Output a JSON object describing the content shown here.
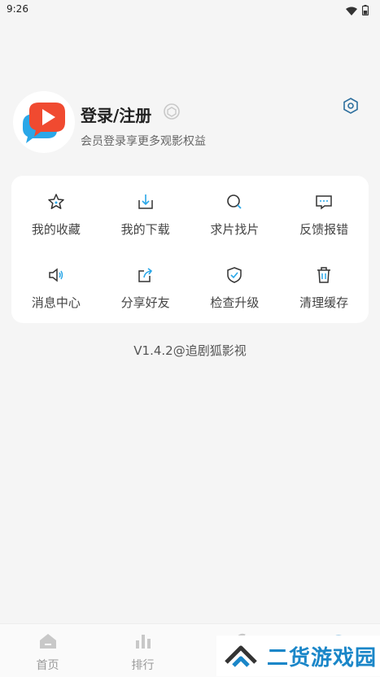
{
  "status": {
    "time": "9:26"
  },
  "profile": {
    "title": "登录/注册",
    "subtitle": "会员登录享更多观影权益"
  },
  "menu": {
    "items": [
      {
        "label": "我的收藏",
        "icon": "star-icon"
      },
      {
        "label": "我的下载",
        "icon": "download-icon"
      },
      {
        "label": "求片找片",
        "icon": "search-icon"
      },
      {
        "label": "反馈报错",
        "icon": "feedback-icon"
      },
      {
        "label": "消息中心",
        "icon": "speaker-icon"
      },
      {
        "label": "分享好友",
        "icon": "share-icon"
      },
      {
        "label": "检查升级",
        "icon": "shield-check-icon"
      },
      {
        "label": "清理缓存",
        "icon": "trash-icon"
      }
    ]
  },
  "version": "V1.4.2@追剧狐影视",
  "tabs": [
    {
      "label": "首页",
      "icon": "home-icon"
    },
    {
      "label": "排行",
      "icon": "rank-icon"
    },
    {
      "label": "",
      "icon": "tab3-icon"
    },
    {
      "label": "",
      "icon": "tab4-icon"
    }
  ],
  "watermark": {
    "text": "二货游戏园"
  },
  "colors": {
    "accent": "#1a86c8",
    "brand": "#f04a30",
    "background": "#f5f5f5"
  }
}
